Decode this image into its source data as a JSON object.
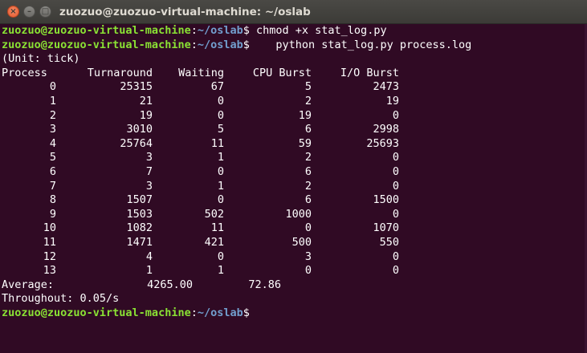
{
  "window": {
    "title": "zuozuo@zuozuo-virtual-machine: ~/oslab",
    "buttons": {
      "close": "×",
      "minimize": "–",
      "maximize": "□"
    }
  },
  "prompt": {
    "user_host": "zuozuo@zuozuo-virtual-machine",
    "colon": ":",
    "path": "~/oslab",
    "symbol": "$"
  },
  "commands": [
    " chmod +x stat_log.py",
    "    python stat_log.py process.log"
  ],
  "output": {
    "unit_line": "(Unit: tick)",
    "headers": {
      "process": "Process",
      "turnaround": "Turnaround",
      "waiting": "Waiting",
      "cpu_burst": "CPU Burst",
      "io_burst": "I/O Burst"
    },
    "rows": [
      {
        "process": "0",
        "turnaround": "25315",
        "waiting": "67",
        "cpu_burst": "5",
        "io_burst": "2473"
      },
      {
        "process": "1",
        "turnaround": "21",
        "waiting": "0",
        "cpu_burst": "2",
        "io_burst": "19"
      },
      {
        "process": "2",
        "turnaround": "19",
        "waiting": "0",
        "cpu_burst": "19",
        "io_burst": "0"
      },
      {
        "process": "3",
        "turnaround": "3010",
        "waiting": "5",
        "cpu_burst": "6",
        "io_burst": "2998"
      },
      {
        "process": "4",
        "turnaround": "25764",
        "waiting": "11",
        "cpu_burst": "59",
        "io_burst": "25693"
      },
      {
        "process": "5",
        "turnaround": "3",
        "waiting": "1",
        "cpu_burst": "2",
        "io_burst": "0"
      },
      {
        "process": "6",
        "turnaround": "7",
        "waiting": "0",
        "cpu_burst": "6",
        "io_burst": "0"
      },
      {
        "process": "7",
        "turnaround": "3",
        "waiting": "1",
        "cpu_burst": "2",
        "io_burst": "0"
      },
      {
        "process": "8",
        "turnaround": "1507",
        "waiting": "0",
        "cpu_burst": "6",
        "io_burst": "1500"
      },
      {
        "process": "9",
        "turnaround": "1503",
        "waiting": "502",
        "cpu_burst": "1000",
        "io_burst": "0"
      },
      {
        "process": "10",
        "turnaround": "1082",
        "waiting": "11",
        "cpu_burst": "0",
        "io_burst": "1070"
      },
      {
        "process": "11",
        "turnaround": "1471",
        "waiting": "421",
        "cpu_burst": "500",
        "io_burst": "550"
      },
      {
        "process": "12",
        "turnaround": "4",
        "waiting": "0",
        "cpu_burst": "3",
        "io_burst": "0"
      },
      {
        "process": "13",
        "turnaround": "1",
        "waiting": "1",
        "cpu_burst": "0",
        "io_burst": "0"
      }
    ],
    "average": {
      "label": "Average:",
      "turnaround": "4265.00",
      "waiting": "72.86"
    },
    "throughput_line": "Throughout: 0.05/s"
  },
  "colors": {
    "background": "#300a24",
    "titlebar": "#3c3b37",
    "prompt_user": "#8ae234",
    "prompt_path": "#729fcf",
    "text": "#ffffff",
    "close_button": "#e2582f"
  }
}
